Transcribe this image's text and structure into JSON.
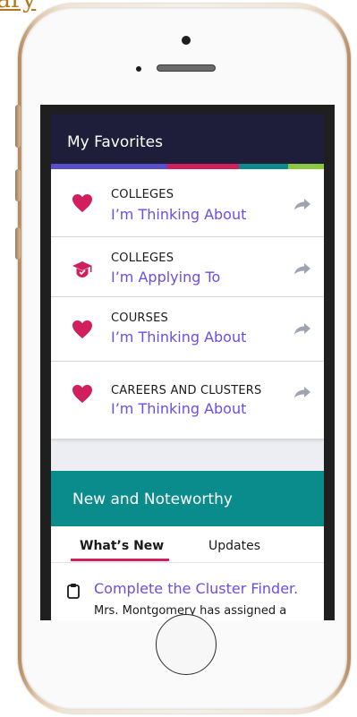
{
  "top_link": {
    "text": "ary"
  },
  "favorites": {
    "title": "My Favorites",
    "color_segments": [
      "#5b4fc9",
      "#d11f5e",
      "#0b8c8c",
      "#8dc63f"
    ],
    "items": [
      {
        "category": "COLLEGES",
        "subtitle": "I’m Thinking About",
        "icon": "heart-icon"
      },
      {
        "category": "COLLEGES",
        "subtitle": "I’m Applying To",
        "icon": "graduation-cap-icon"
      },
      {
        "category": "COURSES",
        "subtitle": "I’m Thinking About",
        "icon": "heart-icon"
      },
      {
        "category": "CAREERS AND CLUSTERS",
        "subtitle": "I’m Thinking About",
        "icon": "heart-icon"
      }
    ],
    "accent_color": "#d11f5e"
  },
  "news": {
    "title": "New and Noteworthy",
    "tabs": [
      {
        "label": "What’s New",
        "active": true
      },
      {
        "label": "Updates",
        "active": false
      }
    ],
    "task": {
      "title": "Complete the Cluster Finder.",
      "description": "Mrs. Montgomery has assigned a"
    }
  }
}
